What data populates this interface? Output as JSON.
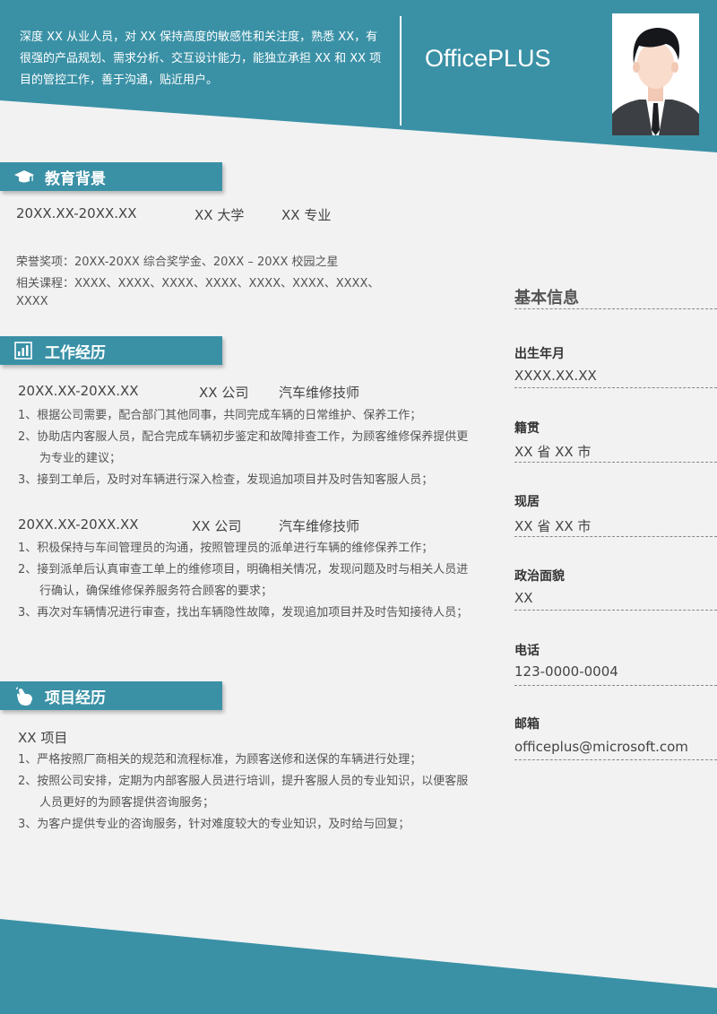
{
  "header": {
    "summary": "深度 XX 从业人员，对 XX 保持高度的敏感性和关注度，熟悉 XX，有很强的产品规划、需求分析、交互设计能力，能独立承担 XX 和 XX 项目的管控工作，善于沟通，贴近用户。",
    "brand": "OfficePLUS"
  },
  "colors": {
    "accent": "#3a91a6",
    "background": "#f2f2f2"
  },
  "education": {
    "title": "教育背景",
    "icon": "graduation-cap-icon",
    "period": "20XX.XX-20XX.XX",
    "school": "XX 大学",
    "major": "XX 专业",
    "honors": "荣誉奖项：20XX-20XX  综合奖学金、20XX  –  20XX 校园之星",
    "courses_line1": "相关课程：XXXX、XXXX、XXXX、XXXX、XXXX、XXXX、XXXX、",
    "courses_line2": "XXXX"
  },
  "work": {
    "title": "工作经历",
    "icon": "bar-chart-icon",
    "jobs": [
      {
        "period": "20XX.XX-20XX.XX",
        "company": "XX 公司",
        "position": "汽车维修技师",
        "items": [
          "1、根据公司需要，配合部门其他同事，共同完成车辆的日常维护、保养工作；",
          "2、协助店内客服人员，配合完成车辆初步鉴定和故障排查工作，为顾客维修保养提供更为专业的建议；",
          "3、接到工单后，及时对车辆进行深入检查，发现追加项目并及时告知客服人员；"
        ]
      },
      {
        "period": "20XX.XX-20XX.XX",
        "company": "XX 公司",
        "position": "汽车维修技师",
        "items": [
          "1、积极保持与车间管理员的沟通，按照管理员的派单进行车辆的维修保养工作；",
          "2、接到派单后认真审查工单上的维修项目，明确相关情况，发现问题及时与相关人员进行确认，确保维修保养服务符合顾客的要求；",
          "3、再次对车辆情况进行审查，找出车辆隐性故障，发现追加项目并及时告知接待人员；"
        ]
      }
    ]
  },
  "project": {
    "title": "项目经历",
    "icon": "hand-pointer-icon",
    "name": "XX 项目",
    "items": [
      "1、严格按照厂商相关的规范和流程标准，为顾客送修和送保的车辆进行处理；",
      "2、按照公司安排，定期为内部客服人员进行培训，提升客服人员的专业知识，以便客服人员更好的为顾客提供咨询服务；",
      "3、为客户提供专业的咨询服务，针对难度较大的专业知识，及时给与回复；"
    ]
  },
  "basic_info": {
    "title": "基本信息",
    "fields": [
      {
        "label": "出生年月",
        "value": "XXXX.XX.XX"
      },
      {
        "label": "籍贯",
        "value": "XX 省 XX 市"
      },
      {
        "label": "现居",
        "value": "XX 省 XX 市"
      },
      {
        "label": "政治面貌",
        "value": "XX"
      },
      {
        "label": "电话",
        "value": "123-0000-0004"
      },
      {
        "label": "邮箱",
        "value": "officeplus@microsoft.com"
      }
    ]
  }
}
